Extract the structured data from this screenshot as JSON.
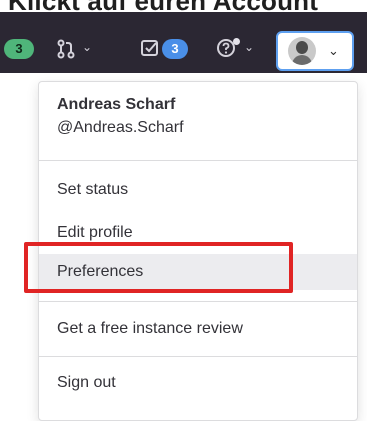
{
  "page_heading_partial": "Klickt auf euren Account",
  "navbar": {
    "issues_count": "3",
    "todos_count": "3"
  },
  "dropdown": {
    "user_name": "Andreas Scharf",
    "user_handle": "@Andreas.Scharf",
    "items": [
      {
        "label": "Set status"
      },
      {
        "label": "Edit profile"
      },
      {
        "label": "Preferences",
        "highlighted": true
      },
      {
        "label": "Get a free instance review"
      },
      {
        "label": "Sign out"
      }
    ]
  },
  "annotation": {
    "highlight_color": "#e02424",
    "highlighted_item": "Preferences"
  },
  "colors": {
    "navbar_bg": "#2b2733",
    "badge_green": "#4fb57a",
    "badge_blue": "#4a8fe8",
    "avatar_focus": "#5ea0f0"
  }
}
